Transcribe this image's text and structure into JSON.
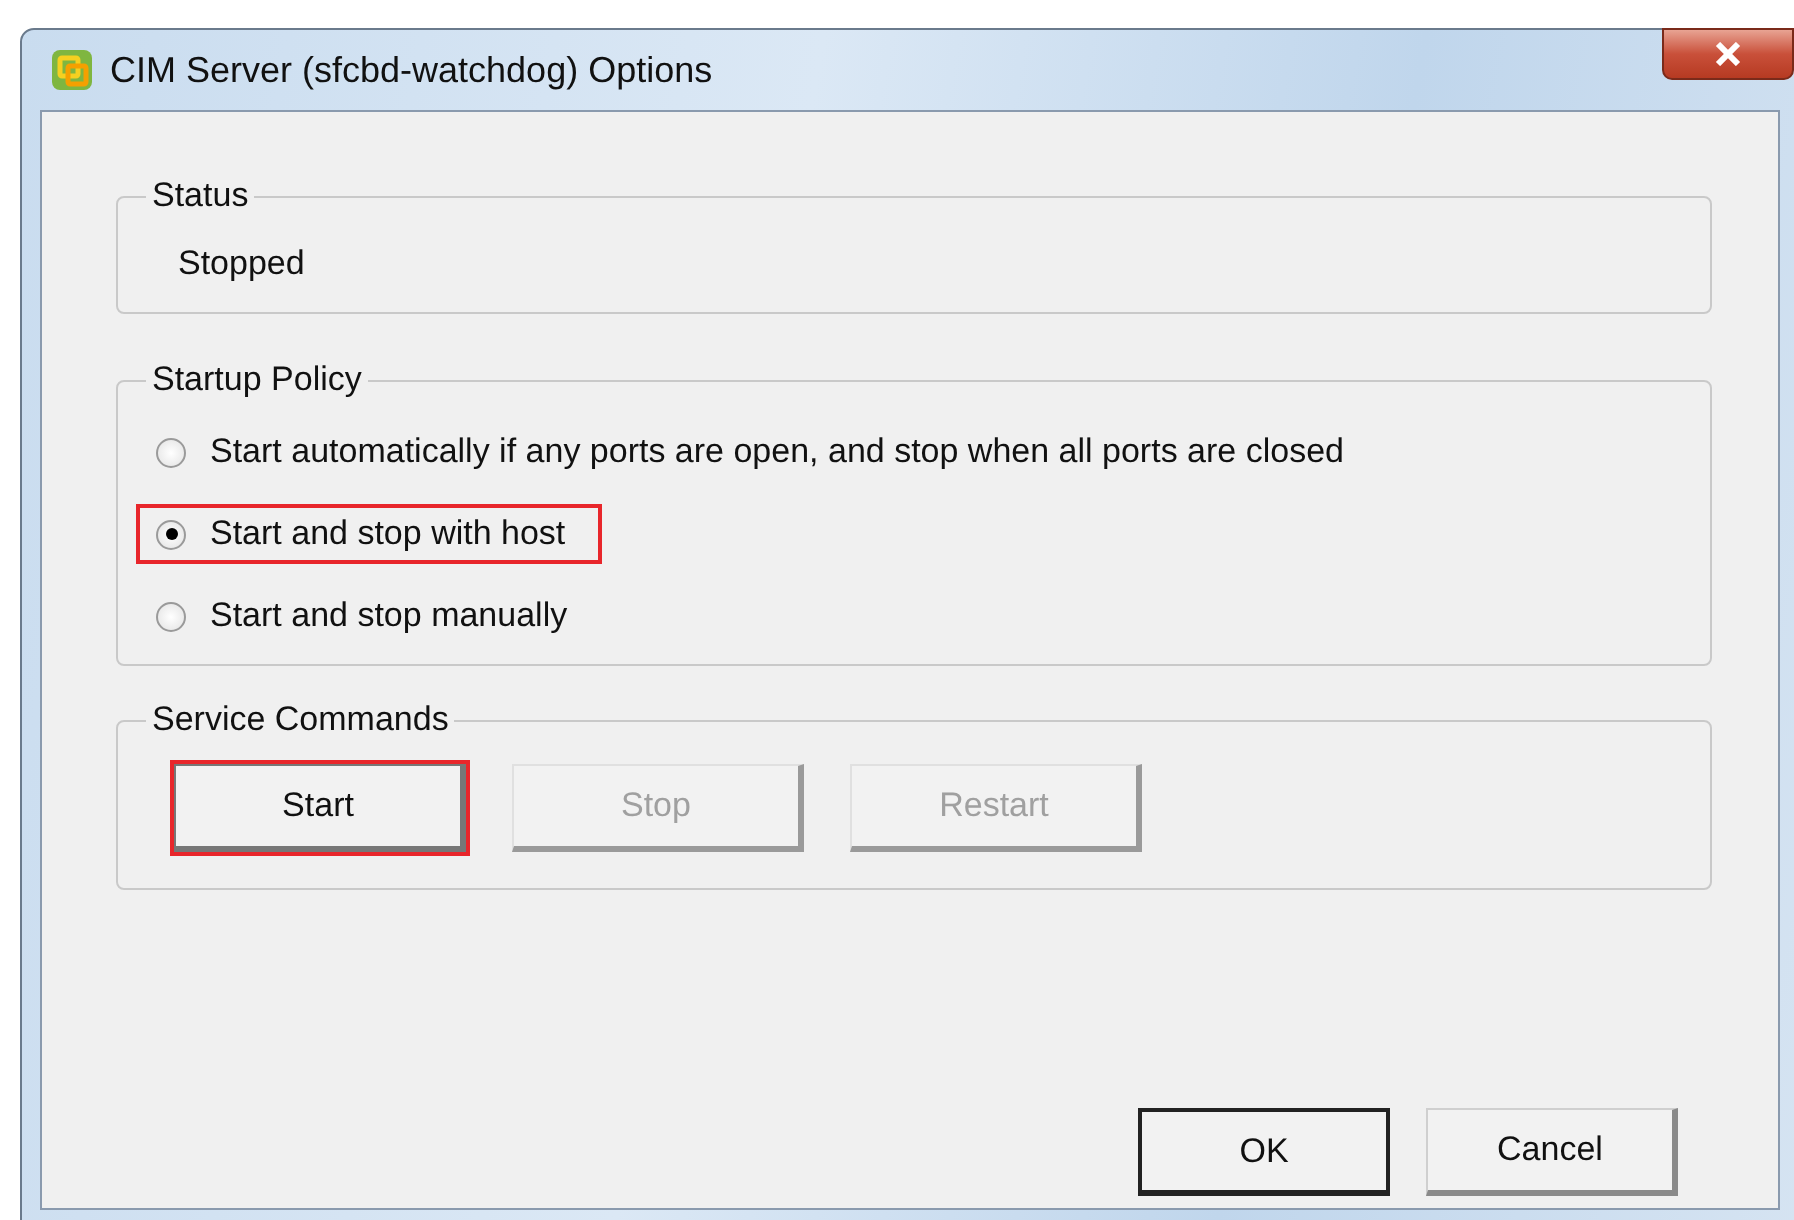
{
  "window": {
    "title": "CIM Server (sfcbd-watchdog) Options"
  },
  "status": {
    "label": "Status",
    "value": "Stopped"
  },
  "startup_policy": {
    "label": "Startup Policy",
    "options": [
      {
        "label": "Start automatically if any ports are open, and stop when all ports are closed",
        "selected": false,
        "highlighted": false
      },
      {
        "label": "Start and stop with host",
        "selected": true,
        "highlighted": true
      },
      {
        "label": "Start and stop manually",
        "selected": false,
        "highlighted": false
      }
    ]
  },
  "service_commands": {
    "label": "Service Commands",
    "buttons": [
      {
        "label": "Start",
        "disabled": false,
        "highlighted": true
      },
      {
        "label": "Stop",
        "disabled": true,
        "highlighted": false
      },
      {
        "label": "Restart",
        "disabled": true,
        "highlighted": false
      }
    ]
  },
  "buttons": [
    {
      "label": "OK",
      "default": true
    },
    {
      "label": "Cancel",
      "default": false
    }
  ]
}
